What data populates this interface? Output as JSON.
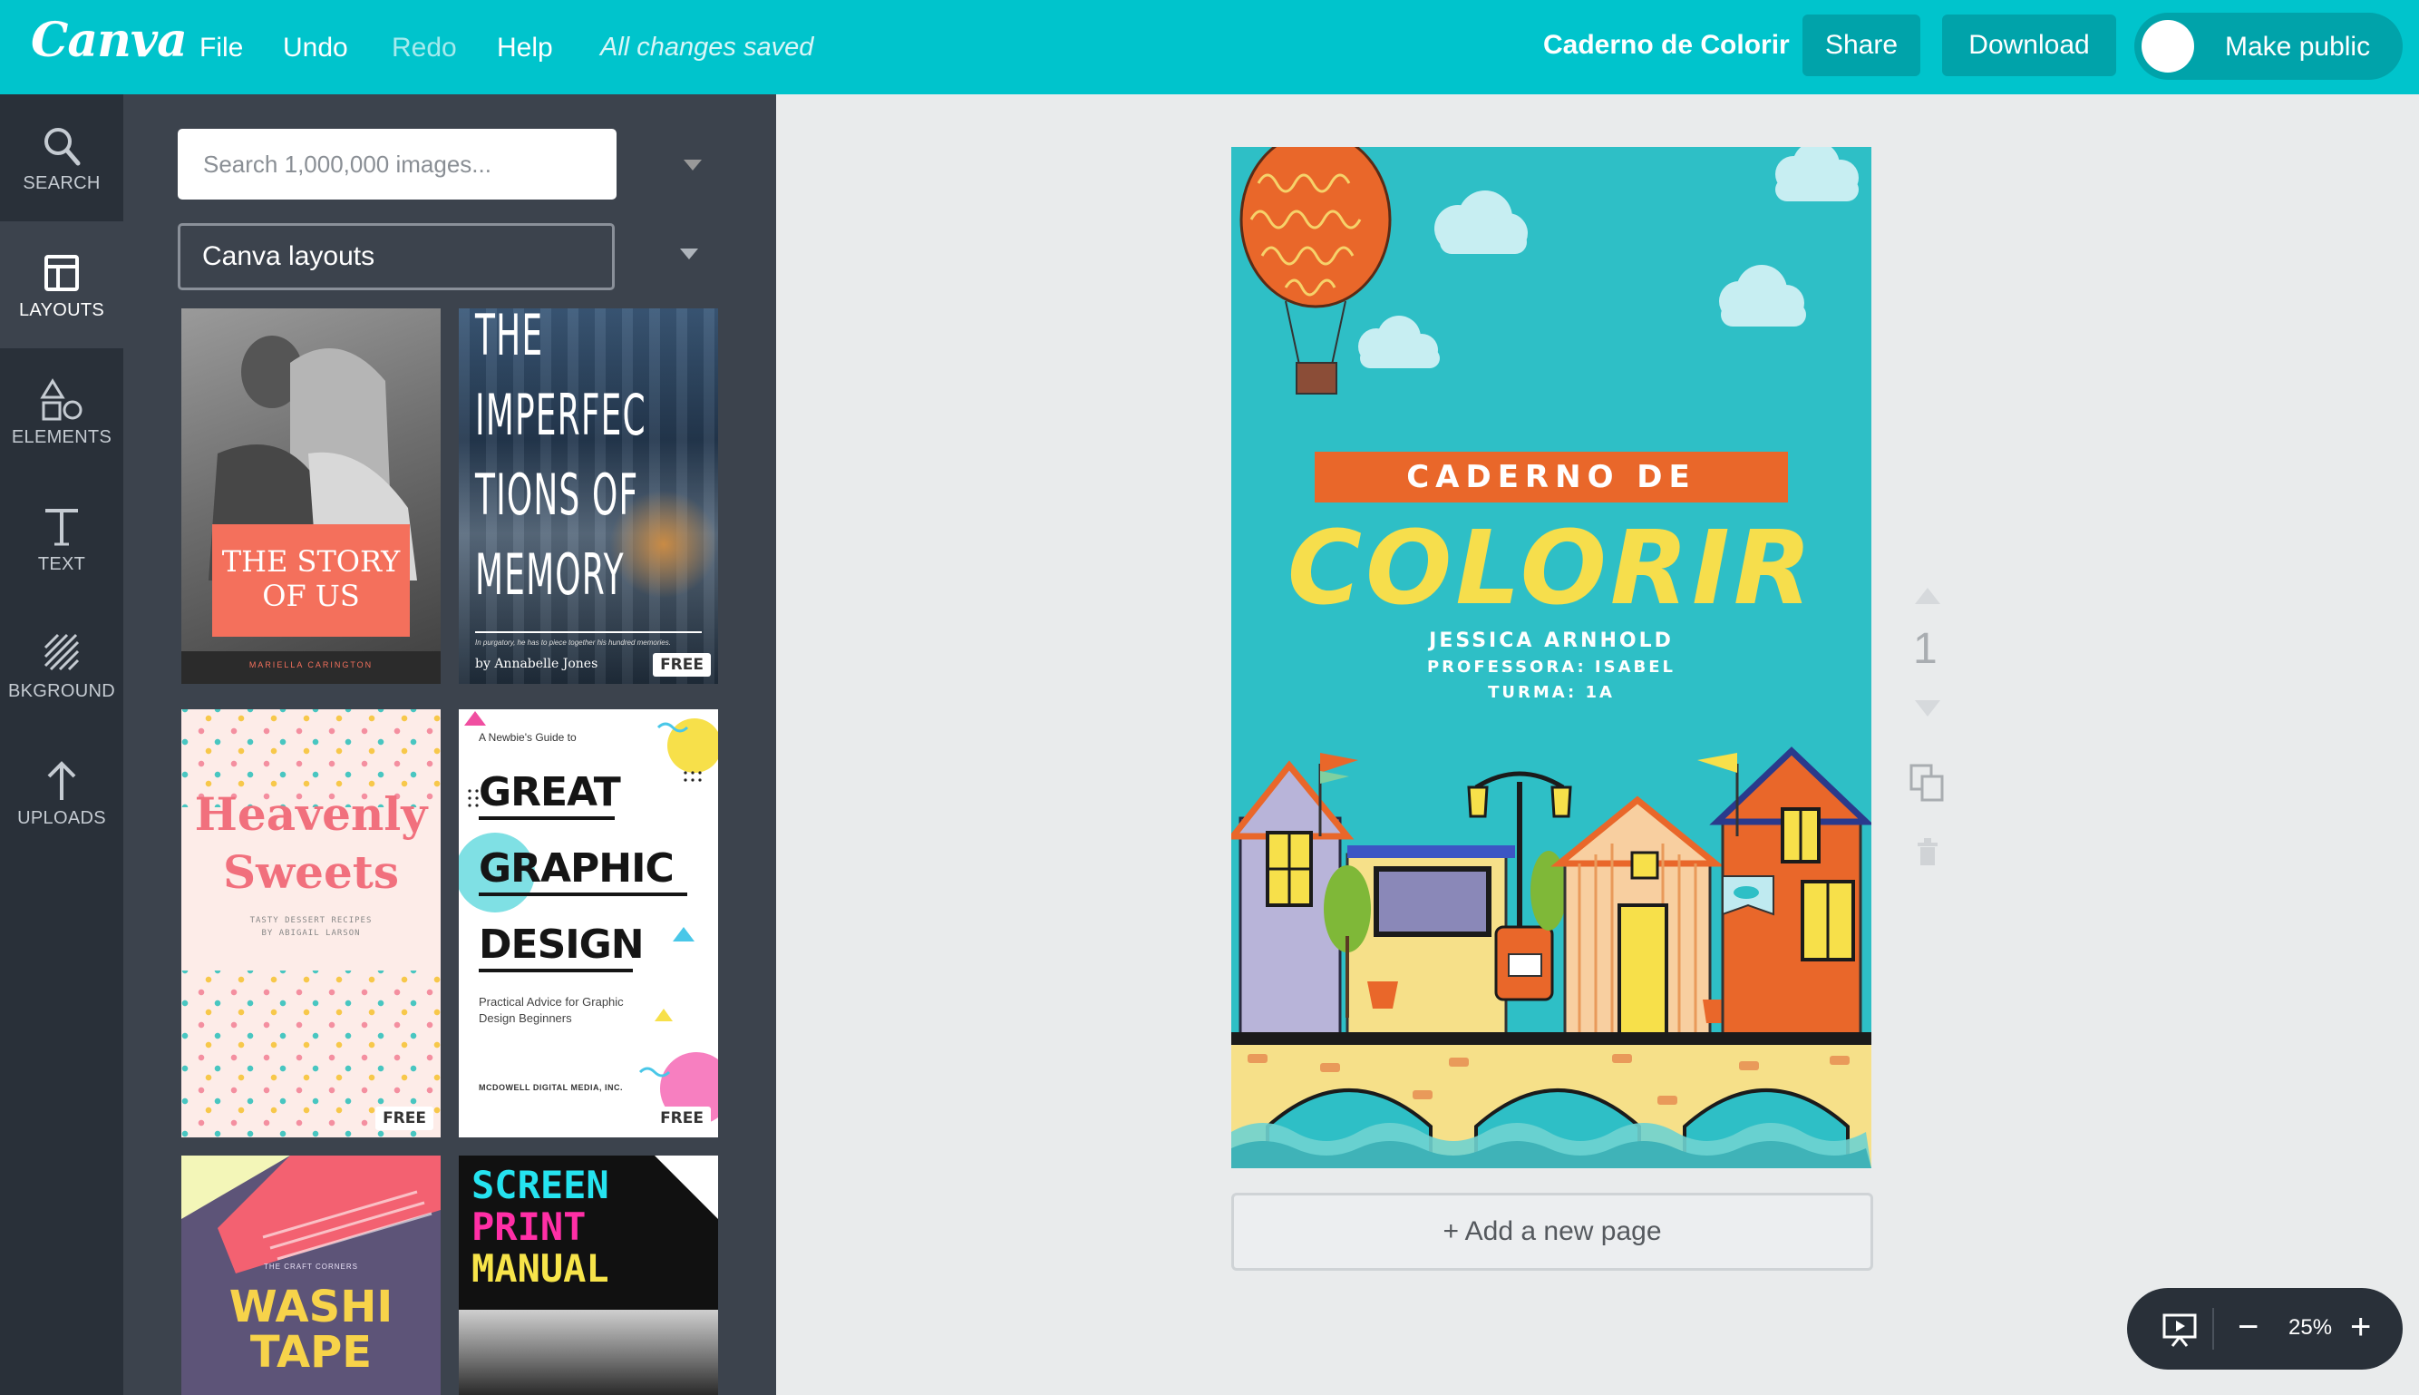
{
  "topbar": {
    "logo": "Canva",
    "menu": [
      "File",
      "Undo",
      "Redo",
      "Help"
    ],
    "saved_status": "All changes saved",
    "doc_title": "Caderno de Colorir",
    "share_label": "Share",
    "download_label": "Download",
    "make_public_label": "Make public"
  },
  "rail": {
    "items": [
      {
        "label": "SEARCH",
        "icon": "magnifier"
      },
      {
        "label": "LAYOUTS",
        "icon": "layout-grid"
      },
      {
        "label": "ELEMENTS",
        "icon": "shapes"
      },
      {
        "label": "TEXT",
        "icon": "letter-t"
      },
      {
        "label": "BKGROUND",
        "icon": "diagonal-lines"
      },
      {
        "label": "UPLOADS",
        "icon": "arrow-up"
      }
    ]
  },
  "panel": {
    "search_placeholder": "Search 1,000,000 images...",
    "select_value": "Canva layouts",
    "free_badge": "FREE",
    "layouts": {
      "story": {
        "title_1": "THE STORY",
        "title_2": "OF US",
        "author": "MARIELLA CARINGTON"
      },
      "memory": {
        "title_lines": [
          "THE",
          "IMPERFEC",
          "TIONS OF",
          "MEMORY"
        ],
        "blurb": "In purgatory, he has to piece together his hundred memories.",
        "author": "by Annabelle Jones"
      },
      "sweets": {
        "title_1": "Heavenly",
        "title_2": "Sweets",
        "sub_1": "TASTY DESSERT RECIPES",
        "sub_2": "BY ABIGAIL LARSON"
      },
      "graphic": {
        "kicker": "A Newbie's Guide to",
        "lines": [
          "GREAT",
          "GRAPHIC",
          "DESIGN"
        ],
        "sub": "Practical Advice for Graphic Design Beginners",
        "publisher": "MCDOWELL DIGITAL MEDIA, INC."
      },
      "washi": {
        "kicker": "THE CRAFT CORNERS",
        "title_1": "WASHI",
        "title_2": "TAPE"
      },
      "screen": {
        "line_1": "SCREEN",
        "line_2": "PRINT",
        "line_3": "MANUAL"
      }
    }
  },
  "canvas": {
    "banner": "CADERNO DE",
    "title": "COLORIR",
    "lines": [
      "JESSICA ARNHOLD",
      "PROFESSORA: ISABEL",
      "TURMA: 1A"
    ],
    "add_page_label": "+ Add a new page",
    "page_number": "1"
  },
  "zoom": {
    "minus": "−",
    "level": "25%",
    "plus": "+"
  },
  "colors": {
    "brand": "#00c4cc",
    "rail": "#293039",
    "panel": "#3c434d",
    "cover_bg": "#2ebfc6",
    "banner": "#e9672a",
    "title": "#f6de4c"
  }
}
